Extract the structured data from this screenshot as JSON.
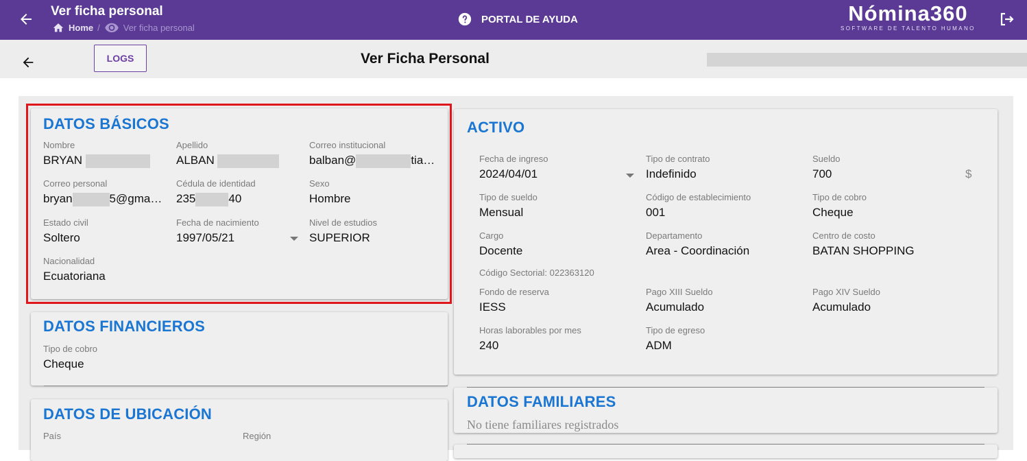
{
  "header": {
    "title": "Ver ficha personal",
    "breadcrumb_home": "Home",
    "breadcrumb_sep": "/",
    "breadcrumb_current": "Ver ficha personal",
    "help_label": "PORTAL DE AYUDA",
    "logo_brand": "Nómina360",
    "logo_tagline": "SOFTWARE DE TALENTO HUMANO"
  },
  "subheader": {
    "logs_label": "LOGS",
    "page_title": "Ver Ficha Personal"
  },
  "datos_basicos": {
    "title": "DATOS BÁSICOS",
    "nombre_label": "Nombre",
    "nombre_value": "BRYAN",
    "apellido_label": "Apellido",
    "apellido_value": "ALBAN",
    "correo_inst_label": "Correo institucional",
    "correo_inst_prefix": "balban@",
    "correo_inst_suffix": "tia…",
    "correo_personal_label": "Correo personal",
    "correo_personal_prefix": "bryan",
    "correo_personal_suffix": "5@gma…",
    "cedula_label": "Cédula de identidad",
    "cedula_prefix": "235",
    "cedula_suffix": "40",
    "sexo_label": "Sexo",
    "sexo_value": "Hombre",
    "estado_civil_label": "Estado civil",
    "estado_civil_value": "Soltero",
    "fecha_nac_label": "Fecha de nacimiento",
    "fecha_nac_value": "1997/05/21",
    "nivel_estudios_label": "Nivel de estudios",
    "nivel_estudios_value": "SUPERIOR",
    "nacionalidad_label": "Nacionalidad",
    "nacionalidad_value": "Ecuatoriana"
  },
  "datos_financieros": {
    "title": "DATOS FINANCIEROS",
    "tipo_cobro_label": "Tipo de cobro",
    "tipo_cobro_value": "Cheque"
  },
  "datos_ubicacion": {
    "title": "DATOS DE UBICACIÓN",
    "pais_label": "País",
    "region_label": "Región"
  },
  "activo": {
    "title": "ACTIVO",
    "fecha_ingreso_label": "Fecha de ingreso",
    "fecha_ingreso_value": "2024/04/01",
    "tipo_contrato_label": "Tipo de contrato",
    "tipo_contrato_value": "Indefinido",
    "sueldo_label": "Sueldo",
    "sueldo_value": "700",
    "currency_symbol": "$",
    "tipo_sueldo_label": "Tipo de sueldo",
    "tipo_sueldo_value": "Mensual",
    "codigo_estab_label": "Código de establecimiento",
    "codigo_estab_value": "001",
    "tipo_cobro_label": "Tipo de cobro",
    "tipo_cobro_value": "Cheque",
    "cargo_label": "Cargo",
    "cargo_value": "Docente",
    "departamento_label": "Departamento",
    "departamento_value": "Area - Coordinación",
    "centro_costo_label": "Centro de costo",
    "centro_costo_value": "BATAN SHOPPING",
    "codigo_sectorial": "Código Sectorial: 022363120",
    "fondo_reserva_label": "Fondo de reserva",
    "fondo_reserva_value": "IESS",
    "pago_xiii_label": "Pago XIII Sueldo",
    "pago_xiii_value": "Acumulado",
    "pago_xiv_label": "Pago XIV Sueldo",
    "pago_xiv_value": "Acumulado",
    "horas_label": "Horas laborables por mes",
    "horas_value": "240",
    "tipo_egreso_label": "Tipo de egreso",
    "tipo_egreso_value": "ADM"
  },
  "datos_familiares": {
    "title": "DATOS FAMILIARES",
    "empty_text": "No tiene familiares registrados"
  },
  "colors": {
    "header_bg": "#5b3a96",
    "section_title": "#1a76d2",
    "highlight_border": "#e0161d"
  }
}
